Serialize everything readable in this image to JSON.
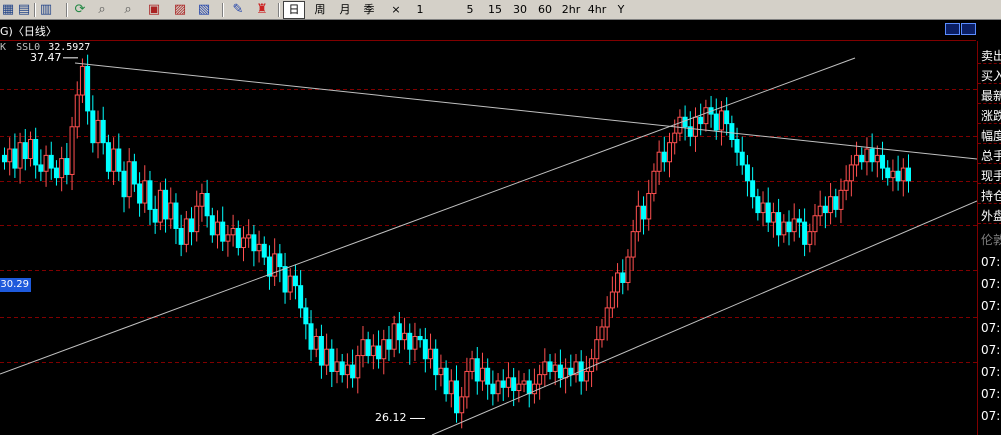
{
  "toolbar": {
    "icons": [
      "grid-icon",
      "table-icon",
      "report-icon",
      "refresh-icon",
      "zoom-in-icon",
      "zoom-out-icon",
      "indicator-icon",
      "export-icon",
      "import-icon",
      "draw-icon",
      "alert-icon"
    ],
    "periods": [
      {
        "label": "日",
        "active": true
      },
      {
        "label": "周",
        "active": false
      },
      {
        "label": "月",
        "active": false
      },
      {
        "label": "季",
        "active": false
      },
      {
        "label": "×",
        "active": false
      },
      {
        "label": "1",
        "active": false
      },
      {
        "label": "5",
        "active": false
      },
      {
        "label": "15",
        "active": false
      },
      {
        "label": "30",
        "active": false
      },
      {
        "label": "60",
        "active": false
      },
      {
        "label": "2hr",
        "active": false
      },
      {
        "label": "4hr",
        "active": false
      },
      {
        "label": "Y",
        "active": false
      }
    ]
  },
  "title": {
    "text": "⁠(G)(日线)",
    "display": "G)〈日线〉"
  },
  "indicator": {
    "prefix": "K",
    "name": "SSL0",
    "value": "32.5927"
  },
  "price_labels": {
    "high": "37.47",
    "low": "26.12",
    "crosshair": "30.29"
  },
  "side_panel": {
    "items": [
      "卖出",
      "买入",
      "最新",
      "涨跌",
      "幅度",
      "总手",
      "现手",
      "持仓",
      "外盘"
    ],
    "section": "伦敦",
    "times": [
      "07:",
      "07:",
      "07:",
      "07:",
      "07:",
      "07:",
      "07:",
      "07:"
    ]
  },
  "colors": {
    "up": "#ff5050",
    "down": "#00ffff",
    "grid": "#800000",
    "trendline": "#c0c0c0"
  },
  "chart_data": {
    "type": "candlestick",
    "title": "",
    "ylim": [
      25.6,
      38.0
    ],
    "high_label": 37.47,
    "low_label": 26.12,
    "current_marker": 30.29,
    "y_gridlines": [
      36.5,
      35.0,
      33.6,
      32.2,
      30.8,
      29.3,
      27.9
    ],
    "closes": [
      34.2,
      34.6,
      34.0,
      34.8,
      34.3,
      34.9,
      34.1,
      33.9,
      34.4,
      34.0,
      33.7,
      34.3,
      33.8,
      35.3,
      36.3,
      37.2,
      35.8,
      34.8,
      35.5,
      34.8,
      33.9,
      34.6,
      33.9,
      33.1,
      34.2,
      33.5,
      32.9,
      33.6,
      32.7,
      32.3,
      33.3,
      32.4,
      32.9,
      32.1,
      31.6,
      32.4,
      32.0,
      32.8,
      33.2,
      32.5,
      31.9,
      32.3,
      31.7,
      31.9,
      32.1,
      31.5,
      31.8,
      31.9,
      31.4,
      31.6,
      31.2,
      30.6,
      31.3,
      30.9,
      30.1,
      30.6,
      30.3,
      29.6,
      29.1,
      28.3,
      28.7,
      27.8,
      28.3,
      27.6,
      27.9,
      27.5,
      27.8,
      27.4,
      28.1,
      28.6,
      28.1,
      28.4,
      28.0,
      28.6,
      28.3,
      29.1,
      28.6,
      28.8,
      28.3,
      28.7,
      28.6,
      28.0,
      28.3,
      27.5,
      27.7,
      26.9,
      27.3,
      26.3,
      26.8,
      27.6,
      28.0,
      27.3,
      27.7,
      27.2,
      26.9,
      27.3,
      27.1,
      27.4,
      27.0,
      27.2,
      27.3,
      26.9,
      27.2,
      27.5,
      27.9,
      27.6,
      27.8,
      27.4,
      27.7,
      27.5,
      27.9,
      27.3,
      27.6,
      28.0,
      28.6,
      29.0,
      29.6,
      30.1,
      30.7,
      30.4,
      31.2,
      32.0,
      32.8,
      32.4,
      33.2,
      33.9,
      34.5,
      34.2,
      34.8,
      35.1,
      35.6,
      35.3,
      35.0,
      35.6,
      35.4,
      35.9,
      35.7,
      35.2,
      35.8,
      35.4,
      34.9,
      34.5,
      34.1,
      33.6,
      33.1,
      32.6,
      32.9,
      32.3,
      32.6,
      31.9,
      32.3,
      32.0,
      32.4,
      32.3,
      31.6,
      32.0,
      32.5,
      32.8,
      32.6,
      33.1,
      32.7,
      33.3,
      33.6,
      34.1,
      34.4,
      34.2,
      34.6,
      34.2,
      34.4,
      34.0,
      33.7,
      33.9,
      33.6,
      34.0,
      33.6
    ]
  }
}
